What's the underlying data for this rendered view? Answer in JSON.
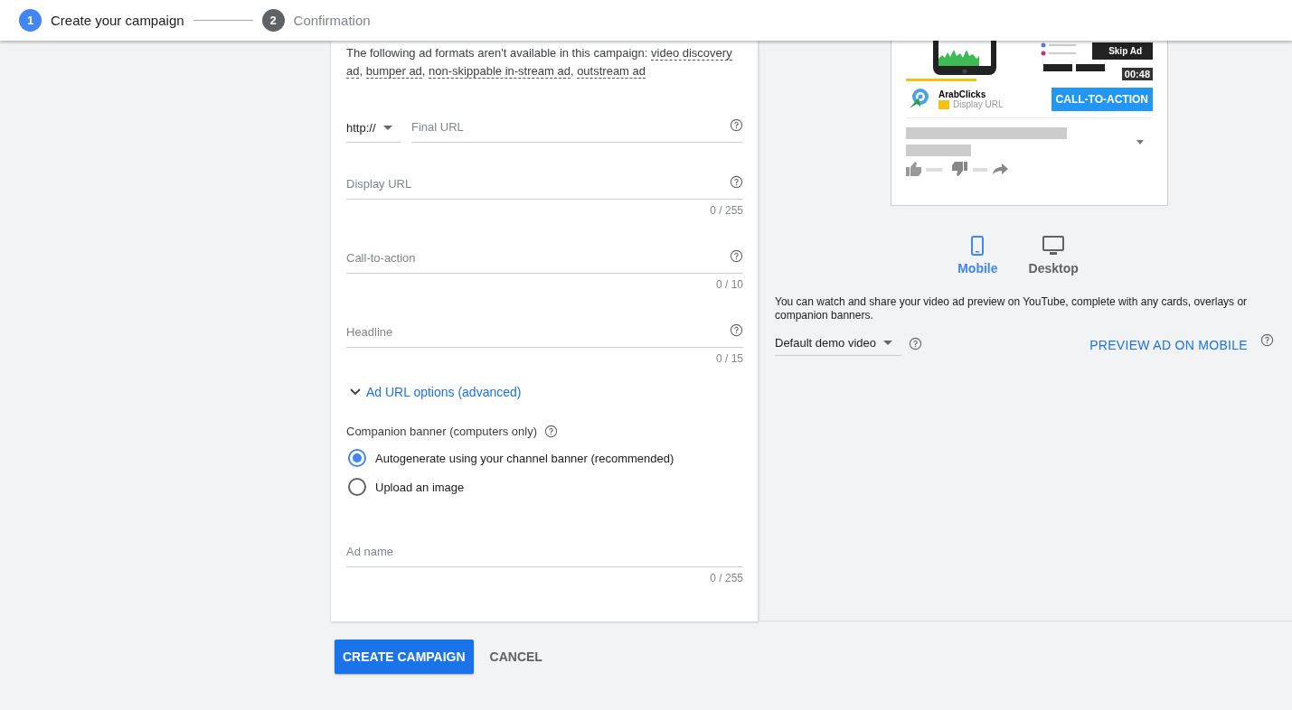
{
  "stepper": [
    {
      "number": "1",
      "label": "Create your campaign",
      "selected": true
    },
    {
      "number": "2",
      "label": "Confirmation",
      "selected": false
    }
  ],
  "form": {
    "notice": [
      {
        "kind": "plain",
        "text": "The following ad formats aren't available in this campaign: "
      },
      {
        "kind": "term",
        "text": "video discovery ad"
      },
      {
        "kind": "plain",
        "text": ", "
      },
      {
        "kind": "term",
        "text": "bumper ad"
      },
      {
        "kind": "plain",
        "text": ", "
      },
      {
        "kind": "term",
        "text": "non-skippable in-stream ad"
      },
      {
        "kind": "plain",
        "text": ", "
      },
      {
        "kind": "term",
        "text": "outstream ad"
      }
    ],
    "fields": [
      {
        "kind": "url",
        "protocol": "http://",
        "placeholder": "Final URL"
      },
      {
        "kind": "text",
        "placeholder": "Display URL",
        "counter": "0 / 255"
      },
      {
        "kind": "text",
        "placeholder": "Call-to-action",
        "counter": "0 / 10"
      },
      {
        "kind": "text",
        "placeholder": "Headline",
        "counter": "0 / 15"
      }
    ],
    "advanced_toggle": {
      "label": "Ad URL options (advanced)",
      "expanded": false
    },
    "companion_banner": {
      "label": "Companion banner (computers only)",
      "options": [
        {
          "label": "Autogenerate using your channel banner (recommended)",
          "selected": true
        },
        {
          "label": "Upload an image",
          "selected": false
        }
      ]
    },
    "ad_name": {
      "placeholder": "Ad name",
      "counter": "0 / 255"
    }
  },
  "preview": {
    "skip_label": "Skip Ad",
    "time": "00:48",
    "advertiser": "ArabClicks",
    "display_url": "Display URL",
    "cta": "CALL-TO-ACTION",
    "devices": [
      {
        "label": "Mobile",
        "kind": "mobile",
        "selected": true
      },
      {
        "label": "Desktop",
        "kind": "desktop",
        "selected": false
      }
    ],
    "description": "You can watch and share your video ad preview on YouTube, complete with any cards, overlays or companion banners.",
    "video_select": "Default demo video",
    "preview_link": "PREVIEW AD ON MOBILE"
  },
  "actions": [
    {
      "label": "CREATE CAMPAIGN",
      "kind": "primary"
    },
    {
      "label": "CANCEL",
      "kind": "text"
    }
  ]
}
